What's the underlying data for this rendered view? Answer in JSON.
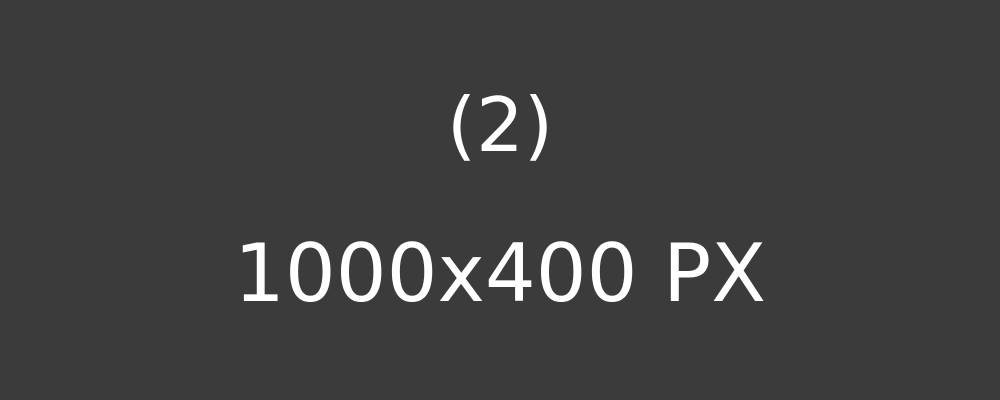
{
  "placeholder": {
    "index_label": "(2)",
    "size_label": "1000x400 PX",
    "background_color": "#3b3b3b",
    "text_color": "#ffffff"
  }
}
